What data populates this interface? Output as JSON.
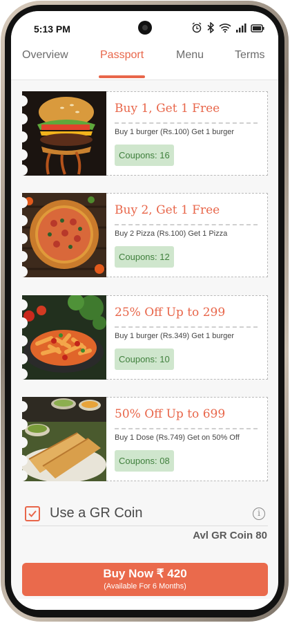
{
  "status_bar": {
    "time": "5:13 PM"
  },
  "tabs": [
    {
      "label": "Overview"
    },
    {
      "label": "Passport"
    },
    {
      "label": "Menu"
    },
    {
      "label": "Terms"
    }
  ],
  "active_tab": "Passport",
  "coupons": [
    {
      "title": "Buy 1, Get 1 Free",
      "description": "Buy 1 burger (Rs.100) Get 1 burger",
      "coupons": "Coupons: 16",
      "image": "burger"
    },
    {
      "title": "Buy 2, Get 1 Free",
      "description": "Buy 2 Pizza (Rs.100) Get 1 Pizza",
      "coupons": "Coupons: 12",
      "image": "pizza"
    },
    {
      "title": "25% Off Up to 299",
      "description": "Buy 1 burger (Rs.349) Get 1 burger",
      "coupons": "Coupons: 10",
      "image": "pasta"
    },
    {
      "title": "50% Off Up to 699",
      "description": "Buy 1 Dose (Rs.749) Get on 50% Off",
      "coupons": "Coupons: 08",
      "image": "dosa"
    }
  ],
  "gr_coin": {
    "label": "Use a GR Coin",
    "checked": true,
    "available": "Avl GR Coin 80"
  },
  "buy_button": {
    "label": "Buy Now ₹ 420",
    "sublabel": "(Available For 6 Months)"
  },
  "colors": {
    "accent": "#e8664a",
    "badge_bg": "#cfe6cd",
    "badge_text": "#3f7f3c"
  }
}
